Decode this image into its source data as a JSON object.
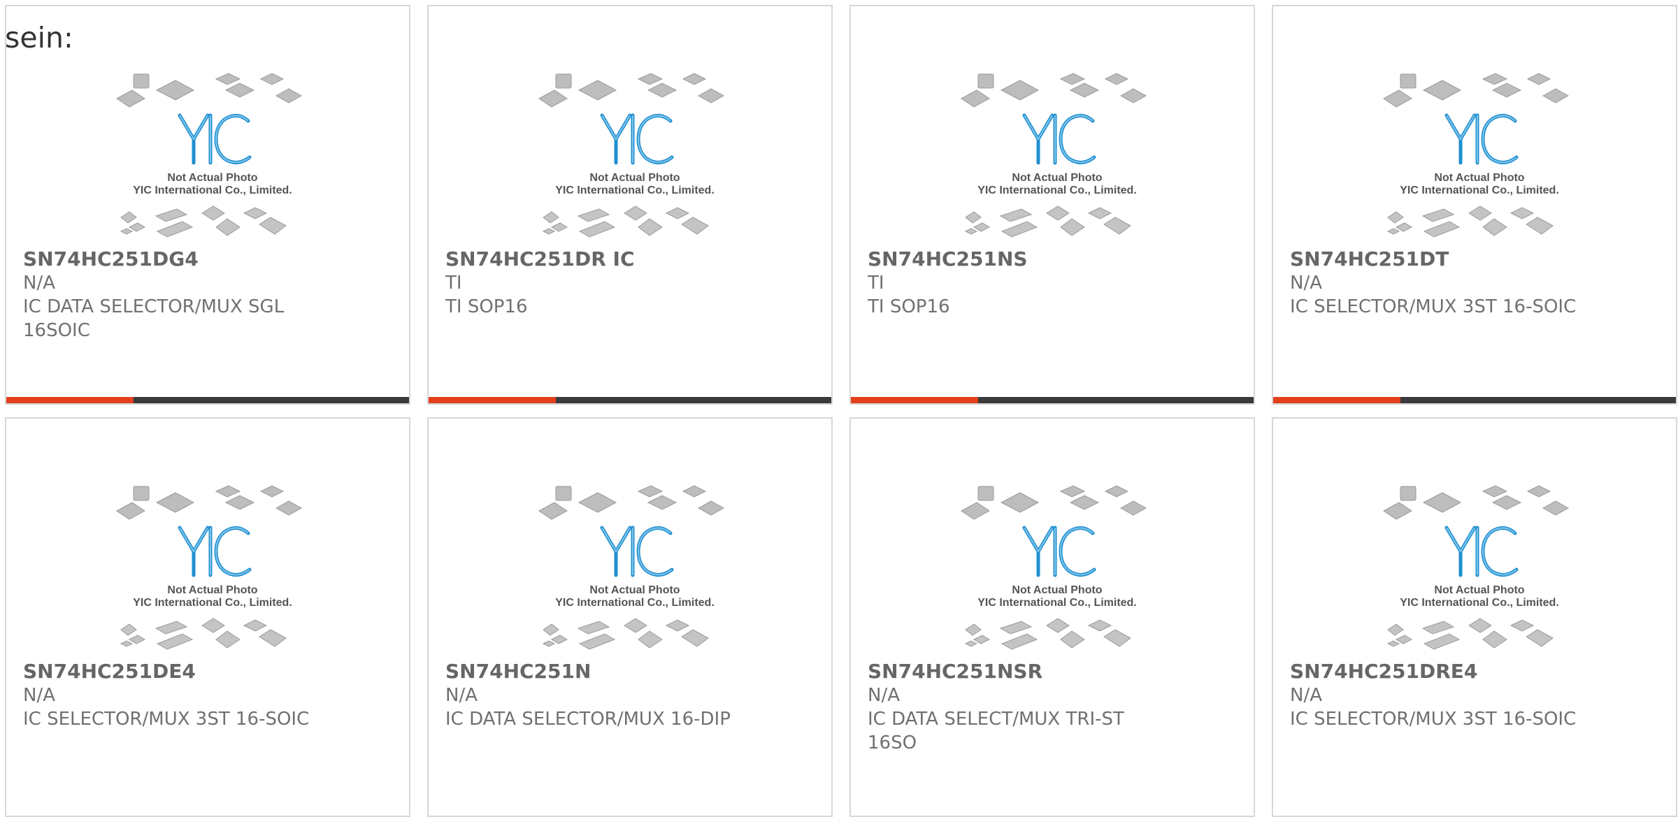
{
  "heading": "sein:",
  "placeholder_image": {
    "line1": "Not Actual Photo",
    "line2": "YIC International Co., Limited.",
    "logo": "YIC"
  },
  "colors": {
    "accent": "#e2401b",
    "bar": "#3a3a3a",
    "logo_blue": "#1f8fd0",
    "border": "#d7d7d7"
  },
  "products": [
    {
      "part": "SN74HC251DG4",
      "mfr": "N/A",
      "desc": "IC DATA SELECTOR/MUX SGL 16SOIC"
    },
    {
      "part": "SN74HC251DR IC",
      "mfr": "TI",
      "desc": "TI SOP16"
    },
    {
      "part": "SN74HC251NS",
      "mfr": "TI",
      "desc": "TI SOP16"
    },
    {
      "part": "SN74HC251DT",
      "mfr": "N/A",
      "desc": "IC SELECTOR/MUX 3ST 16-SOIC"
    },
    {
      "part": "SN74HC251DE4",
      "mfr": "N/A",
      "desc": "IC SELECTOR/MUX 3ST 16-SOIC"
    },
    {
      "part": "SN74HC251N",
      "mfr": "N/A",
      "desc": "IC DATA SELECTOR/MUX 16-DIP"
    },
    {
      "part": "SN74HC251NSR",
      "mfr": "N/A",
      "desc": "IC DATA SELECT/MUX TRI-ST 16SO"
    },
    {
      "part": "SN74HC251DRE4",
      "mfr": "N/A",
      "desc": "IC SELECTOR/MUX 3ST 16-SOIC"
    }
  ]
}
